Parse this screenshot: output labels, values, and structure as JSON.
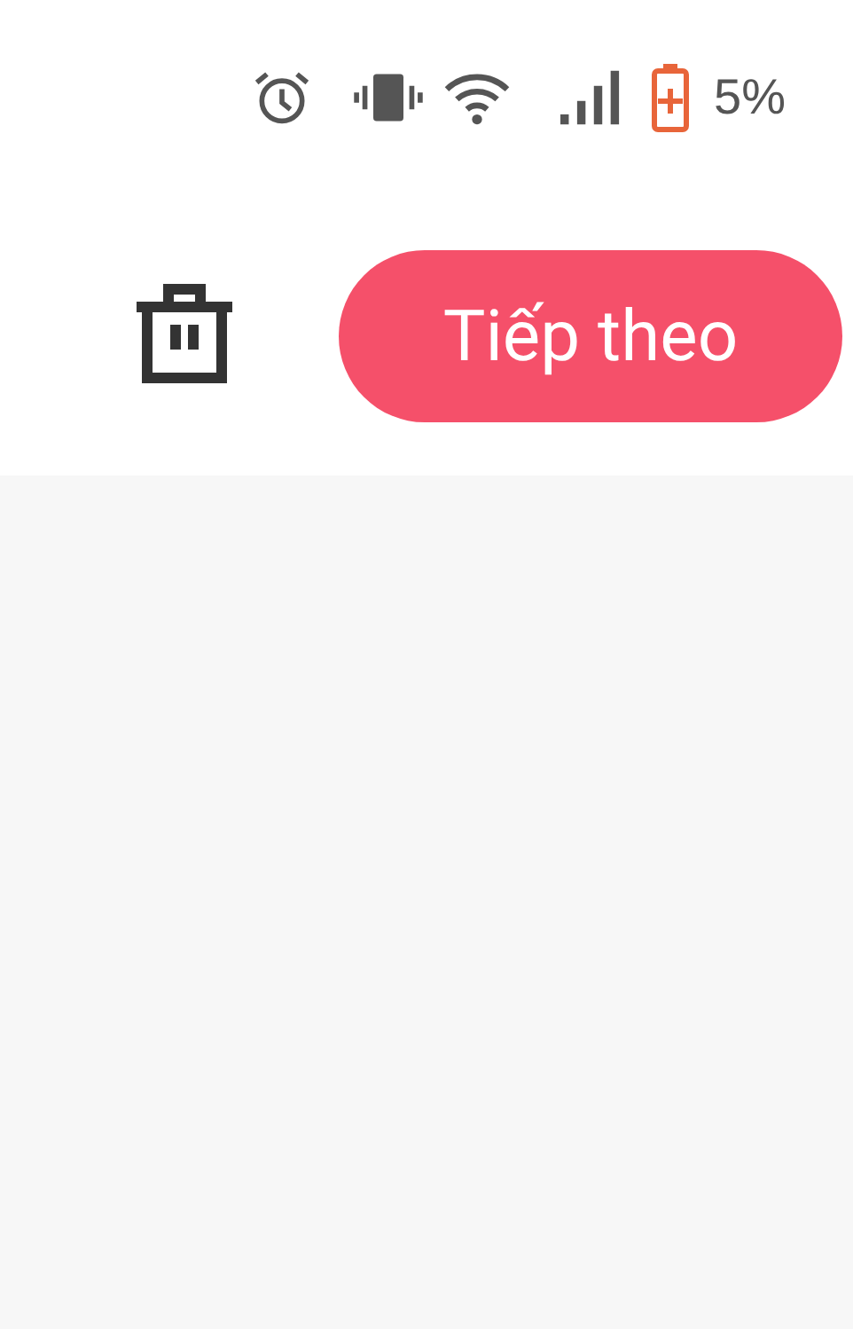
{
  "status_bar": {
    "battery_text": "5%"
  },
  "toolbar": {
    "next_button": "Tiếp theo"
  }
}
